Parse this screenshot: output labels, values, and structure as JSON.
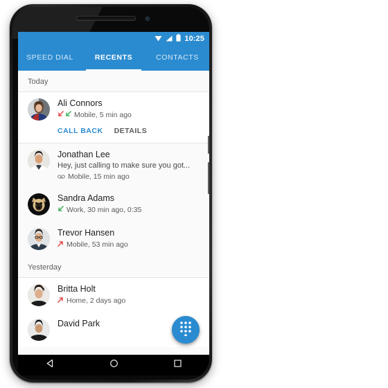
{
  "device": {
    "frame_color": "#1a1a1a",
    "parts": {
      "earpiece": "earpiece-speaker",
      "front_camera": "front-camera",
      "bottom_speaker": "bottom-speaker",
      "power_button": "power-button",
      "volume_button": "volume-button"
    }
  },
  "theme": {
    "accent": "#2b8bd0",
    "missed_call": "#e23b3b",
    "received_call": "#2eaa4a",
    "outgoing_call": "#e23b3b",
    "voicemail": "#8a8a8a",
    "surface": "#ffffff",
    "background": "#fafafa",
    "text_primary": "#212121",
    "text_secondary": "#5a5a5a"
  },
  "status_bar": {
    "time": "10:25",
    "icons": [
      "wifi-icon",
      "cellular-signal-icon",
      "battery-icon"
    ]
  },
  "tabs": [
    {
      "label": "SPEED DIAL",
      "active": false
    },
    {
      "label": "RECENTS",
      "active": true
    },
    {
      "label": "CONTACTS",
      "active": false
    }
  ],
  "sections": [
    {
      "header": "Today",
      "items": [
        {
          "name": "Ali Connors",
          "snippet": "",
          "meta": "Mobile, 5 min ago",
          "call_icons": [
            "missed-incoming-arrow-icon",
            "received-incoming-arrow-icon"
          ],
          "expanded": true,
          "actions": [
            {
              "label": "CALL BACK",
              "style": "primary"
            },
            {
              "label": "DETAILS",
              "style": "secondary"
            }
          ]
        },
        {
          "name": "Jonathan Lee",
          "snippet": "Hey, just calling to make sure you got...",
          "meta": "Mobile, 15 min ago",
          "call_icons": [
            "voicemail-icon"
          ],
          "expanded": false,
          "actions": []
        },
        {
          "name": "Sandra Adams",
          "snippet": "",
          "meta": "Work, 30 min ago, 0:35",
          "call_icons": [
            "received-incoming-arrow-icon"
          ],
          "expanded": false,
          "actions": []
        },
        {
          "name": "Trevor Hansen",
          "snippet": "",
          "meta": "Mobile, 53 min ago",
          "call_icons": [
            "outgoing-arrow-icon"
          ],
          "expanded": false,
          "actions": []
        }
      ]
    },
    {
      "header": "Yesterday",
      "items": [
        {
          "name": "Britta Holt",
          "snippet": "",
          "meta": "Home, 2 days ago",
          "call_icons": [
            "outgoing-arrow-icon"
          ],
          "expanded": false,
          "actions": []
        },
        {
          "name": "David Park",
          "snippet": "",
          "meta": "",
          "call_icons": [],
          "expanded": false,
          "actions": []
        }
      ]
    }
  ],
  "fab": {
    "icon": "dialpad-icon",
    "color": "#2b8bd0"
  },
  "nav_bar": {
    "buttons": [
      "back-icon",
      "home-icon",
      "recents-icon"
    ]
  }
}
